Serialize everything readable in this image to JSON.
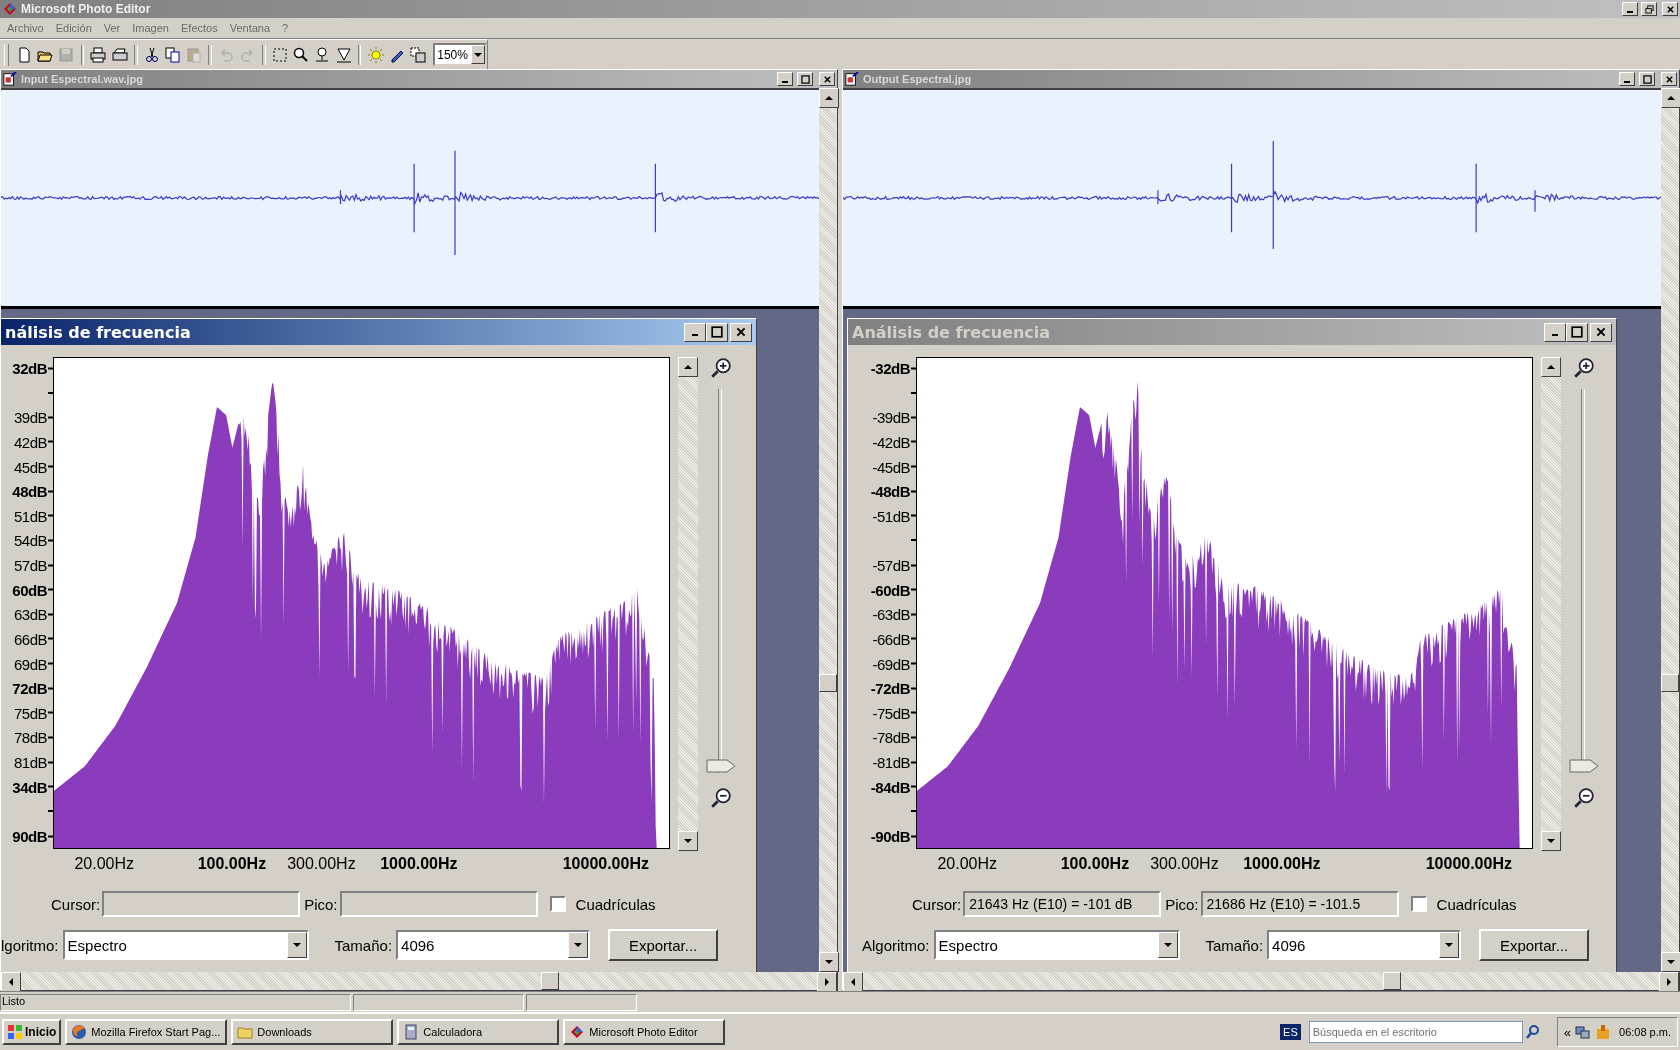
{
  "app": {
    "title": "Microsoft Photo Editor"
  },
  "menu": [
    "Archivo",
    "Edición",
    "Ver",
    "Imagen",
    "Efectos",
    "Ventana",
    "?"
  ],
  "toolbar": {
    "buttons": [
      {
        "disabled": false
      },
      {
        "disabled": false
      },
      {
        "disabled": true
      },
      {
        "disabled": false
      },
      {
        "disabled": false
      },
      {
        "disabled": false
      },
      {
        "disabled": false
      },
      {
        "disabled": true
      },
      {
        "disabled": true
      },
      {
        "disabled": true
      },
      {
        "disabled": false
      },
      {
        "disabled": false
      },
      {
        "disabled": false
      },
      {
        "disabled": false
      },
      {
        "disabled": false
      },
      {
        "disabled": false
      },
      {
        "disabled": false
      }
    ],
    "zoom": "150%"
  },
  "windows": [
    {
      "title": "Input Espectral.wav.jpg",
      "dialog": {
        "title": "nálisis de frecuencia",
        "active": true,
        "y_axis": [
          {
            "kind": "label",
            "text": "32dB",
            "bold": true
          },
          {
            "kind": "tick"
          },
          {
            "kind": "label",
            "text": "39dB",
            "bold": false
          },
          {
            "kind": "label",
            "text": "42dB",
            "bold": false
          },
          {
            "kind": "label",
            "text": "45dB",
            "bold": false
          },
          {
            "kind": "label",
            "text": "48dB",
            "bold": true
          },
          {
            "kind": "label",
            "text": "51dB",
            "bold": false
          },
          {
            "kind": "label",
            "text": "54dB",
            "bold": false
          },
          {
            "kind": "label",
            "text": "57dB",
            "bold": false
          },
          {
            "kind": "label",
            "text": "60dB",
            "bold": true
          },
          {
            "kind": "label",
            "text": "63dB",
            "bold": false
          },
          {
            "kind": "label",
            "text": "66dB",
            "bold": false
          },
          {
            "kind": "label",
            "text": "69dB",
            "bold": false
          },
          {
            "kind": "label",
            "text": "72dB",
            "bold": true
          },
          {
            "kind": "label",
            "text": "75dB",
            "bold": false
          },
          {
            "kind": "label",
            "text": "78dB",
            "bold": false
          },
          {
            "kind": "label",
            "text": "81dB",
            "bold": false
          },
          {
            "kind": "label",
            "text": "34dB",
            "bold": true
          },
          {
            "kind": "tick"
          },
          {
            "kind": "label",
            "text": "90dB",
            "bold": true
          }
        ],
        "x_axis": [
          {
            "text": "20.00Hz",
            "bold": false
          },
          {
            "text": "100.00Hz",
            "bold": true
          },
          {
            "text": "300.00Hz",
            "bold": false
          },
          {
            "text": "1000.00Hz",
            "bold": true
          },
          {
            "text": "10000.00Hz",
            "bold": true
          }
        ],
        "zoom_slider": {
          "level": 0
        },
        "cursor": {
          "label": "Cursor:"
        },
        "peak": {
          "label": "Pico:"
        },
        "gridlines": {
          "label": "Cuadrículas",
          "checked": false
        },
        "algorithm": {
          "label": "lgoritmo:",
          "value": "Espectro"
        },
        "size": {
          "label": "Tamaño:",
          "value": "4096"
        },
        "export": "Exportar..."
      }
    },
    {
      "title": "Output Espectral.jpg",
      "dialog": {
        "title": "Análisis de frecuencia",
        "active": false,
        "y_axis": [
          {
            "kind": "label",
            "text": "-32dB",
            "bold": true
          },
          {
            "kind": "tick"
          },
          {
            "kind": "label",
            "text": "-39dB",
            "bold": false
          },
          {
            "kind": "label",
            "text": "-42dB",
            "bold": false
          },
          {
            "kind": "label",
            "text": "-45dB",
            "bold": false
          },
          {
            "kind": "label",
            "text": "-48dB",
            "bold": true
          },
          {
            "kind": "label",
            "text": "-51dB",
            "bold": false
          },
          {
            "kind": "tick"
          },
          {
            "kind": "label",
            "text": "-57dB",
            "bold": false
          },
          {
            "kind": "label",
            "text": "-60dB",
            "bold": true
          },
          {
            "kind": "label",
            "text": "-63dB",
            "bold": false
          },
          {
            "kind": "label",
            "text": "-66dB",
            "bold": false
          },
          {
            "kind": "label",
            "text": "-69dB",
            "bold": false
          },
          {
            "kind": "label",
            "text": "-72dB",
            "bold": true
          },
          {
            "kind": "label",
            "text": "-75dB",
            "bold": false
          },
          {
            "kind": "label",
            "text": "-78dB",
            "bold": false
          },
          {
            "kind": "label",
            "text": "-81dB",
            "bold": false
          },
          {
            "kind": "label",
            "text": "-84dB",
            "bold": true
          },
          {
            "kind": "tick"
          },
          {
            "kind": "label",
            "text": "-90dB",
            "bold": true
          }
        ],
        "x_axis": [
          {
            "text": "20.00Hz",
            "bold": false
          },
          {
            "text": "100.00Hz",
            "bold": true
          },
          {
            "text": "300.00Hz",
            "bold": false
          },
          {
            "text": "1000.00Hz",
            "bold": true
          },
          {
            "text": "10000.00Hz",
            "bold": true
          }
        ],
        "zoom_slider": {
          "level": 0
        },
        "cursor": {
          "label": "Cursor:",
          "value": "21643 Hz (E10) = -101 dB"
        },
        "peak": {
          "label": "Pico:",
          "value": "21686 Hz (E10) = -101.5"
        },
        "gridlines": {
          "label": "Cuadrículas",
          "checked": false
        },
        "algorithm": {
          "label": "Algoritmo:",
          "value": "Espectro"
        },
        "size": {
          "label": "Tamaño:",
          "value": "4096"
        },
        "export": "Exportar..."
      }
    }
  ],
  "status_bar": {
    "text": "Listo"
  },
  "taskbar": {
    "start": "Inicio",
    "tasks": [
      {
        "label": "Mozilla Firefox Start Pag...",
        "selected": false
      },
      {
        "label": "Downloads",
        "selected": false
      },
      {
        "label": "Calculadora",
        "selected": false
      },
      {
        "label": "Microsoft Photo Editor",
        "selected": false
      }
    ],
    "language": "ES",
    "search": {
      "placeholder": "Búsqueda en el escritorio"
    },
    "tray_expand": "«",
    "clock": "06:08 p.m."
  }
}
